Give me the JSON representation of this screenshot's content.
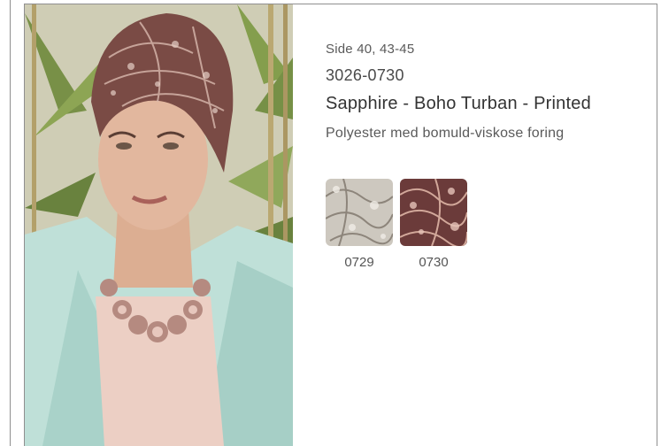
{
  "product": {
    "page_ref": "Side 40, 43-45",
    "article_number": "3026-0730",
    "name": "Sapphire - Boho Turban - Printed",
    "material": "Polyester med bomuld-viskose foring"
  },
  "swatches": [
    {
      "code": "0729",
      "color": "#cfc9c0"
    },
    {
      "code": "0730",
      "color": "#6b3b3a"
    }
  ],
  "colors": {
    "border": "#8f8f8f",
    "text": "#444444"
  }
}
